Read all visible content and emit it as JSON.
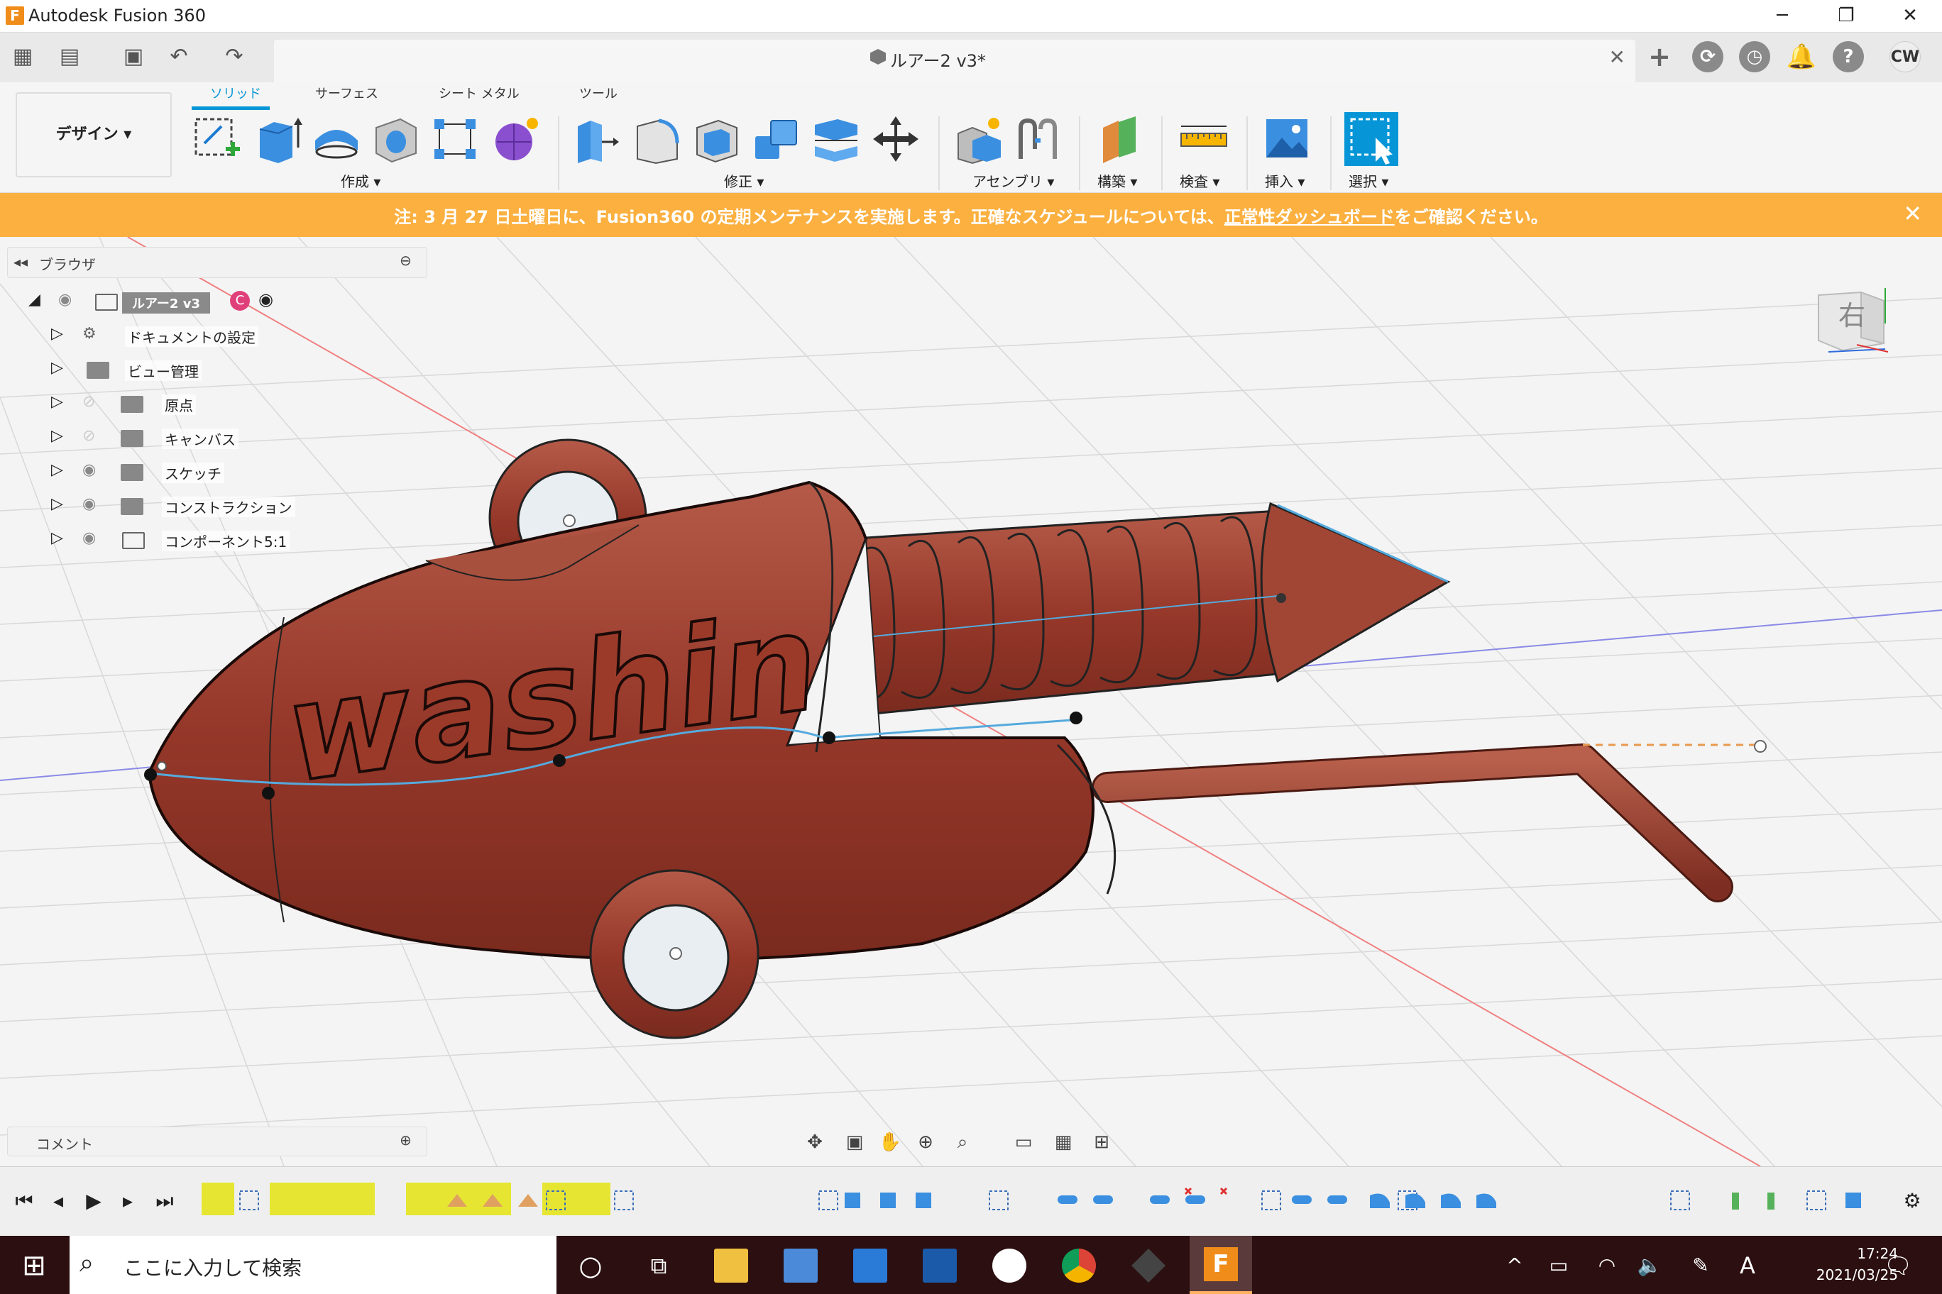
{
  "window": {
    "title": "Autodesk Fusion 360"
  },
  "document_tab": {
    "name": "ルアー2 v3*"
  },
  "user_initials": "CW",
  "workspace": {
    "label": "デザイン ▾"
  },
  "toolbar_tabs": [
    "ソリッド",
    "サーフェス",
    "シート メタル",
    "ツール"
  ],
  "tool_groups": [
    "作成 ▾",
    "修正 ▾",
    "アセンブリ ▾",
    "構築 ▾",
    "検査 ▾",
    "挿入 ▾",
    "選択 ▾"
  ],
  "banner": {
    "prefix": "注: 3 月 27 日土曜日に、Fusion360 の定期メンテナンスを実施します。正確なスケジュールについては、",
    "link": "正常性ダッシュボード",
    "suffix": "をご確認ください。"
  },
  "browser": {
    "title": "ブラウザ",
    "root": "ルアー2 v3",
    "items": [
      "ドキュメントの設定",
      "ビュー管理",
      "原点",
      "キャンバス",
      "スケッチ",
      "コンストラクション",
      "コンポーネント5:1"
    ]
  },
  "comment": {
    "title": "コメント"
  },
  "viewcube": {
    "label": "右"
  },
  "model_text": "washin",
  "taskbar": {
    "search_placeholder": "ここに入力して検索",
    "time": "17:24",
    "date": "2021/03/25"
  },
  "colors": {
    "accent": "#0696d7",
    "banner": "#fbb040",
    "model": "#9c3a2a",
    "taskbar": "#2c0f10"
  }
}
